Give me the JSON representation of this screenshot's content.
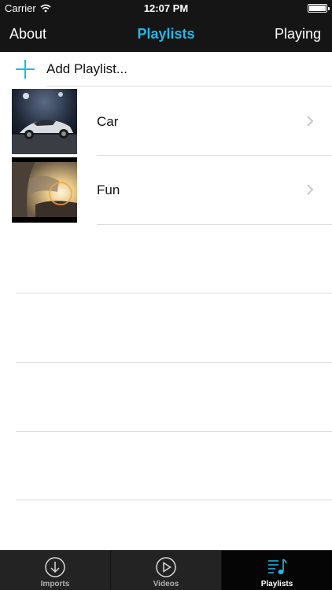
{
  "status_bar": {
    "carrier": "Carrier",
    "time": "12:07 PM"
  },
  "nav": {
    "left": "About",
    "title": "Playlists",
    "right": "Playing"
  },
  "add_row": {
    "label": "Add Playlist..."
  },
  "playlists": [
    {
      "name": "Car",
      "thumbnail": "car-thumbnail"
    },
    {
      "name": "Fun",
      "thumbnail": "car-interior-thumbnail"
    }
  ],
  "tabs": [
    {
      "label": "Imports",
      "icon": "download-circle-icon",
      "active": false
    },
    {
      "label": "Videos",
      "icon": "play-circle-icon",
      "active": false
    },
    {
      "label": "Playlists",
      "icon": "playlist-music-icon",
      "active": true
    }
  ],
  "colors": {
    "accent": "#23b8e6",
    "bar": "#151515",
    "tabbar": "#232323",
    "tab_active": "#050505"
  }
}
